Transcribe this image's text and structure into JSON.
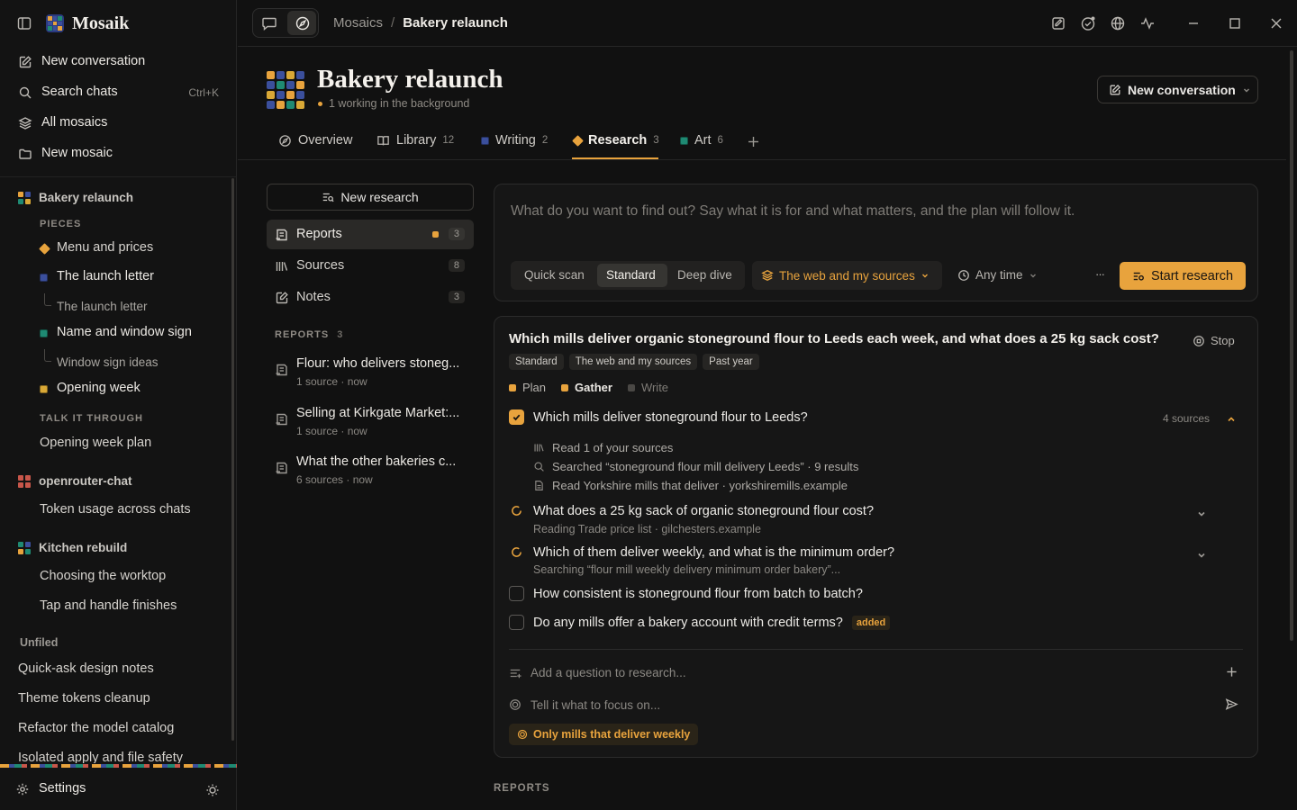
{
  "app": {
    "name": "Mosaik"
  },
  "sidebar": {
    "top_items": [
      {
        "label": "New conversation",
        "icon": "edit-icon"
      },
      {
        "label": "Search chats",
        "icon": "search-icon",
        "shortcut": "Ctrl+K"
      },
      {
        "label": "All mosaics",
        "icon": "layers-icon"
      },
      {
        "label": "New mosaic",
        "icon": "folder-icon"
      }
    ],
    "mosaic_bakery": {
      "title": "Bakery relaunch",
      "pieces_label": "PIECES",
      "pieces": [
        {
          "label": "Menu and prices",
          "color": "#e8a33d"
        },
        {
          "label": "The launch letter",
          "color": "#3b4f9c",
          "child": "The launch letter"
        },
        {
          "label": "Name and window sign",
          "color": "#1f8a73",
          "child": "Window sign ideas"
        },
        {
          "label": "Opening week",
          "color": "#d9a836"
        }
      ],
      "talk_label": "TALK IT THROUGH",
      "talk_items": [
        "Opening week plan"
      ]
    },
    "mosaic_openrouter": {
      "title": "openrouter-chat",
      "items": [
        "Token usage across chats"
      ]
    },
    "mosaic_kitchen": {
      "title": "Kitchen rebuild",
      "items": [
        "Choosing the worktop",
        "Tap and handle finishes"
      ]
    },
    "unfiled_label": "Unfiled",
    "unfiled_items": [
      "Quick-ask design notes",
      "Theme tokens cleanup",
      "Refactor the model catalog",
      "Isolated apply and file safety"
    ],
    "settings_label": "Settings"
  },
  "topbar": {
    "breadcrumb_root": "Mosaics",
    "breadcrumb_sep": "/",
    "breadcrumb_current": "Bakery relaunch"
  },
  "header": {
    "title": "Bakery relaunch",
    "status": "1 working in the background",
    "new_conversation": "New conversation"
  },
  "tabs": [
    {
      "label": "Overview"
    },
    {
      "label": "Library",
      "count": "12"
    },
    {
      "label": "Writing",
      "count": "2",
      "color": "#3b4f9c"
    },
    {
      "label": "Research",
      "count": "3",
      "color": "#e8a33d",
      "active": true
    },
    {
      "label": "Art",
      "count": "6",
      "color": "#1f8a73"
    }
  ],
  "left_panel": {
    "new_research": "New research",
    "nav": [
      {
        "label": "Reports",
        "count": "3"
      },
      {
        "label": "Sources",
        "count": "8"
      },
      {
        "label": "Notes",
        "count": "3"
      }
    ],
    "reports_label": "REPORTS",
    "reports_count": "3",
    "reports": [
      {
        "title": "Flour: who delivers stoneg...",
        "meta": "1 source · now"
      },
      {
        "title": "Selling at Kirkgate Market:...",
        "meta": "1 source · now"
      },
      {
        "title": "What the other bakeries c...",
        "meta": "6 sources · now"
      }
    ]
  },
  "composer": {
    "placeholder": "What do you want to find out? Say what it is for and what matters, and the plan will follow it.",
    "modes": [
      "Quick scan",
      "Standard",
      "Deep dive"
    ],
    "active_mode": "Standard",
    "sources": "The web and my sources",
    "time": "Any time",
    "more": "···",
    "start": "Start research"
  },
  "job": {
    "title": "Which mills deliver organic stoneground flour to Leeds each week, and what does a 25 kg sack cost?",
    "stop": "Stop",
    "tags": [
      "Standard",
      "The web and my sources",
      "Past year"
    ],
    "phases": [
      {
        "label": "Plan",
        "color": "#e8a33d"
      },
      {
        "label": "Gather",
        "color": "#e8a33d"
      },
      {
        "label": "Write",
        "color": "#4a4845"
      }
    ],
    "questions": [
      {
        "text": "Which mills deliver stoneground flour to Leeds?",
        "state": "done",
        "sources": "4 sources"
      },
      {
        "text": "What does a 25 kg sack of organic stoneground flour cost?",
        "state": "working",
        "sub": "Reading Trade price list · gilchesters.example"
      },
      {
        "text": "Which of them deliver weekly, and what is the minimum order?",
        "state": "working",
        "sub": "Searching “flour mill weekly delivery minimum order bakery”..."
      },
      {
        "text": "How consistent is stoneground flour from batch to batch?",
        "state": "todo"
      },
      {
        "text": "Do any mills offer a bakery account with credit terms?",
        "state": "todo",
        "tag": "added"
      }
    ],
    "steps": [
      {
        "text": "Read 1 of your sources",
        "icon": "library-icon"
      },
      {
        "text": "Searched “stoneground flour mill delivery Leeds” · 9 results",
        "icon": "search-icon"
      },
      {
        "text": "Read Yorkshire mills that deliver · yorkshiremills.example",
        "icon": "page-icon"
      }
    ],
    "add_question": "Add a question to research...",
    "focus_placeholder": "Tell it what to focus on...",
    "focus_chip": "Only mills that deliver weekly"
  },
  "bottom_label": "REPORTS",
  "colors": {
    "accent": "#e8a33d",
    "bg": "#111111"
  }
}
